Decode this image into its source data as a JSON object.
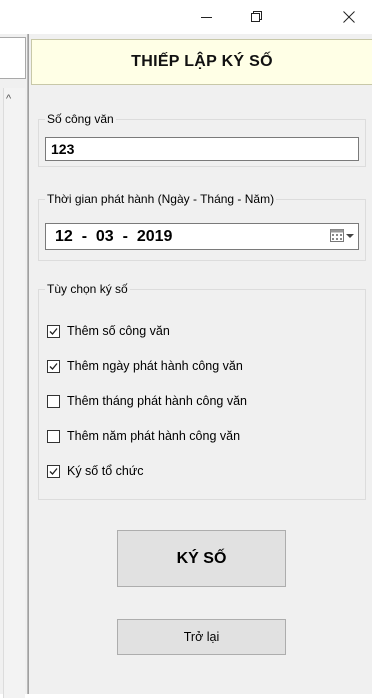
{
  "window": {
    "minimize_icon": "minimize-icon",
    "restore_icon": "restore-icon",
    "close_icon": "close-icon"
  },
  "header": {
    "title": "THIẾP LẬP KÝ SỐ"
  },
  "document_number": {
    "legend": "Số công văn",
    "value": "123"
  },
  "release_date": {
    "legend": "Thời gian phát hành (Ngày - Tháng - Năm)",
    "value": "12  -  03  -  2019",
    "icon": "calendar-icon"
  },
  "sign_options": {
    "legend": "Tùy chọn ký số",
    "items": [
      {
        "label": "Thêm số công văn",
        "checked": true
      },
      {
        "label": "Thêm ngày phát hành công văn",
        "checked": true
      },
      {
        "label": "Thêm tháng phát hành công văn",
        "checked": false
      },
      {
        "label": "Thêm năm phát hành công văn",
        "checked": false
      },
      {
        "label": "Ký số tổ chức",
        "checked": true
      }
    ]
  },
  "buttons": {
    "sign_label": "KÝ SỐ",
    "back_label": "Trở lại"
  }
}
